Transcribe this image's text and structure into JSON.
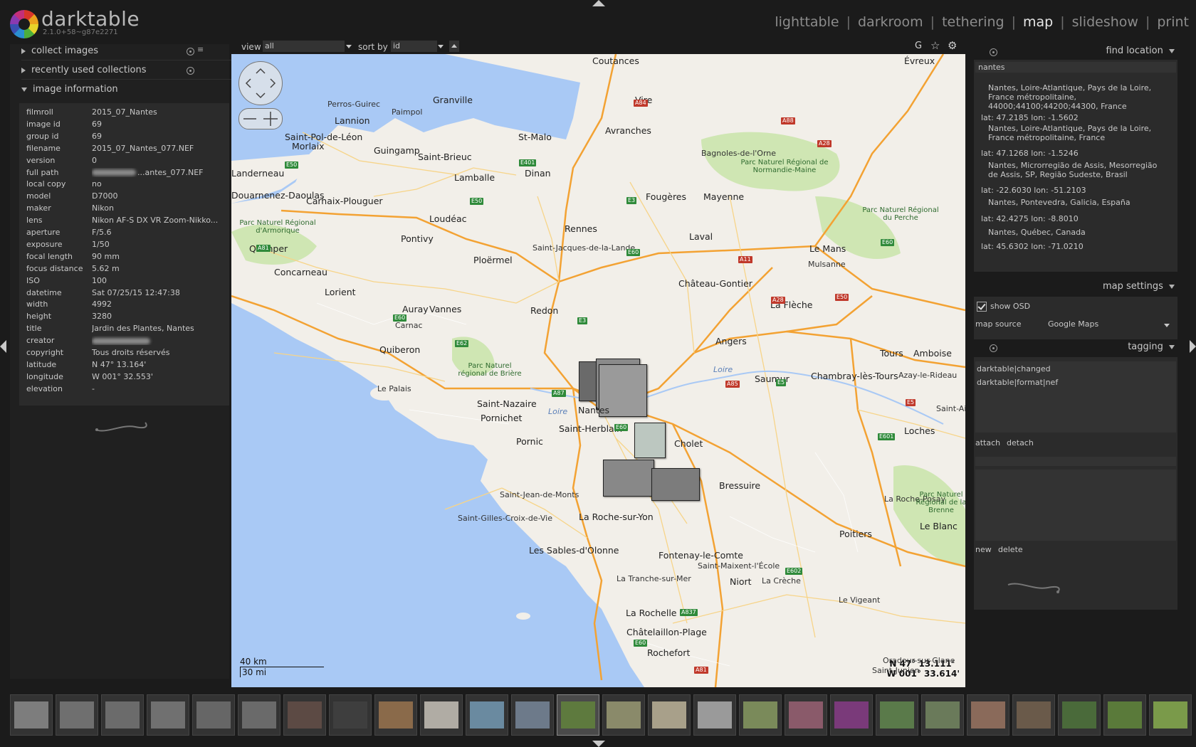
{
  "app": {
    "name": "darktable",
    "version": "2.1.0+58~g87e2271"
  },
  "views": [
    {
      "label": "lighttable",
      "active": false
    },
    {
      "label": "darkroom",
      "active": false
    },
    {
      "label": "tethering",
      "active": false
    },
    {
      "label": "map",
      "active": true
    },
    {
      "label": "slideshow",
      "active": false
    },
    {
      "label": "print",
      "active": false
    }
  ],
  "left_panel": {
    "collect_images": "collect images",
    "recently_used": "recently used collections",
    "image_information": "image information",
    "info": [
      {
        "key": "filmroll",
        "value": "2015_07_Nantes"
      },
      {
        "key": "image id",
        "value": "69"
      },
      {
        "key": "group id",
        "value": "69"
      },
      {
        "key": "filename",
        "value": "2015_07_Nantes_077.NEF"
      },
      {
        "key": "version",
        "value": "0"
      },
      {
        "key": "full path",
        "value": "...antes_077.NEF"
      },
      {
        "key": "local copy",
        "value": "no"
      },
      {
        "key": "model",
        "value": "D7000"
      },
      {
        "key": "maker",
        "value": "Nikon"
      },
      {
        "key": "lens",
        "value": "Nikon AF-S DX VR Zoom-Nikko..."
      },
      {
        "key": "aperture",
        "value": "F/5.6"
      },
      {
        "key": "exposure",
        "value": "1/50"
      },
      {
        "key": "focal length",
        "value": "90 mm"
      },
      {
        "key": "focus distance",
        "value": "5.62 m"
      },
      {
        "key": "ISO",
        "value": "100"
      },
      {
        "key": "datetime",
        "value": "Sat 07/25/15 12:47:38"
      },
      {
        "key": "width",
        "value": "4992"
      },
      {
        "key": "height",
        "value": "3280"
      },
      {
        "key": "title",
        "value": "Jardin des Plantes, Nantes"
      },
      {
        "key": "creator",
        "value": ""
      },
      {
        "key": "copyright",
        "value": "Tous droits réservés"
      },
      {
        "key": "latitude",
        "value": "N 47° 13.164'"
      },
      {
        "key": "longitude",
        "value": "W 001° 32.553'"
      },
      {
        "key": "elevation",
        "value": "-"
      }
    ]
  },
  "toolbar": {
    "view_label": "view",
    "view_value": "all",
    "sort_label": "sort by",
    "sort_value": "id",
    "g_label": "G"
  },
  "map": {
    "scale_km": "40 km",
    "scale_mi": "30 mi",
    "coord_lat": "N 47° 13.111'",
    "coord_lon": "W 001° 33.614'",
    "places": [
      {
        "name": "Coutances"
      },
      {
        "name": "Évreux"
      },
      {
        "name": "Granville"
      },
      {
        "name": "Vire"
      },
      {
        "name": "Perros-Guirec"
      },
      {
        "name": "Paimpol"
      },
      {
        "name": "Lannion"
      },
      {
        "name": "Avranches"
      },
      {
        "name": "St-Malo"
      },
      {
        "name": "Saint-Pol-de-Léon"
      },
      {
        "name": "Morlaix"
      },
      {
        "name": "Guingamp"
      },
      {
        "name": "Saint-Brieuc"
      },
      {
        "name": "Bagnoles-de-l'Orne"
      },
      {
        "name": "Landerneau"
      },
      {
        "name": "Lamballe"
      },
      {
        "name": "Dinan"
      },
      {
        "name": "Fougères"
      },
      {
        "name": "Mayenne"
      },
      {
        "name": "Douarnenez-Daoulas"
      },
      {
        "name": "Carhaix-Plouguer"
      },
      {
        "name": "Loudéac"
      },
      {
        "name": "Rennes"
      },
      {
        "name": "Laval"
      },
      {
        "name": "Le Mans"
      },
      {
        "name": "Quimper"
      },
      {
        "name": "Pontivy"
      },
      {
        "name": "Saint-Jacques-de-la-Lande"
      },
      {
        "name": "Concarneau"
      },
      {
        "name": "Ploërmel"
      },
      {
        "name": "Mulsanne"
      },
      {
        "name": "Château-Gontier"
      },
      {
        "name": "Lorient"
      },
      {
        "name": "La Flèche"
      },
      {
        "name": "Auray"
      },
      {
        "name": "Vannes"
      },
      {
        "name": "Redon"
      },
      {
        "name": "Carnac"
      },
      {
        "name": "Angers"
      },
      {
        "name": "Quiberon"
      },
      {
        "name": "Tours"
      },
      {
        "name": "Amboise"
      },
      {
        "name": "Saumur"
      },
      {
        "name": "Chambray-lès-Tours"
      },
      {
        "name": "Le Palais"
      },
      {
        "name": "Saint-Nazaire"
      },
      {
        "name": "Pornichet"
      },
      {
        "name": "Nantes"
      },
      {
        "name": "Saint-Herblain"
      },
      {
        "name": "Azay-le-Rideau"
      },
      {
        "name": "Pornic"
      },
      {
        "name": "Cholet"
      },
      {
        "name": "Loches"
      },
      {
        "name": "Bressuire"
      },
      {
        "name": "Saint-Jean-de-Monts"
      },
      {
        "name": "La Roche-Posay"
      },
      {
        "name": "Saint-Gilles-Croix-de-Vie"
      },
      {
        "name": "La Roche-sur-Yon"
      },
      {
        "name": "Les Sables-d'Olonne"
      },
      {
        "name": "Poitiers"
      },
      {
        "name": "Le Blanc"
      },
      {
        "name": "Fontenay-le-Comte"
      },
      {
        "name": "Saint-Maixent-l'École"
      },
      {
        "name": "La Tranche-sur-Mer"
      },
      {
        "name": "Niort"
      },
      {
        "name": "La Crèche"
      },
      {
        "name": "Le Vigeant"
      },
      {
        "name": "La Rochelle"
      },
      {
        "name": "Châtelaillon-Plage"
      },
      {
        "name": "Rochefort"
      },
      {
        "name": "Oradour-sur-Glane"
      },
      {
        "name": "Saint-Junien"
      },
      {
        "name": "Saint-Aignan"
      }
    ],
    "parks": [
      {
        "name": "Parc Naturel Régional de Normandie-Maine"
      },
      {
        "name": "Parc Naturel Régional d'Armorique"
      },
      {
        "name": "Parc Naturel Régional du Perche"
      },
      {
        "name": "Parc Naturel régional de Brière"
      },
      {
        "name": "Parc Naturel Régional de la Brenne"
      }
    ],
    "roads": [
      "A84",
      "A88",
      "A28",
      "E401",
      "E50",
      "E3",
      "E50",
      "E60",
      "A81",
      "A11",
      "A28",
      "E50",
      "E60",
      "E3",
      "E60",
      "E62",
      "A87",
      "E60",
      "A85",
      "E5",
      "E5",
      "E601",
      "E602",
      "A837",
      "E60",
      "A81"
    ],
    "rivers": [
      "Loire",
      "Loire"
    ]
  },
  "right_panel": {
    "find_location": "find location",
    "search_value": "nantes",
    "results": [
      {
        "name": "Nantes, Loire-Atlantique, Pays de la Loire, France métropolitaine, 44000;44100;44200;44300, France",
        "coords": "lat: 47.2185 lon: -1.5602"
      },
      {
        "name": "Nantes, Loire-Atlantique, Pays de la Loire, France métropolitaine, France",
        "coords": "lat: 47.1268 lon: -1.5246"
      },
      {
        "name": "Nantes, Microrregião de Assis, Mesorregião de Assis, SP, Região Sudeste, Brasil",
        "coords": "lat: -22.6030 lon: -51.2103"
      },
      {
        "name": "Nantes, Pontevedra, Galicia, España",
        "coords": "lat: 42.4275 lon: -8.8010"
      },
      {
        "name": "Nantes, Québec, Canada",
        "coords": "lat: 45.6302 lon: -71.0210"
      }
    ],
    "map_settings": "map settings",
    "show_osd": "show OSD",
    "map_source_label": "map source",
    "map_source_value": "Google Maps",
    "tagging": "tagging",
    "tags": [
      "darktable|changed",
      "darktable|format|nef"
    ],
    "attach": "attach",
    "detach": "detach",
    "new": "new",
    "delete": "delete"
  },
  "colors": {
    "map_water": "#a9c9f5",
    "map_land": "#f2efe9",
    "park": "#cfe6b3",
    "motorway": "#f3a233",
    "panel": "#202020",
    "background": "#1b1b1b"
  },
  "icons": [
    "darktable-logo-icon",
    "presets-icon",
    "menu-icon",
    "star-icon",
    "gear-icon",
    "osd-pan-icon",
    "osd-zoom-icon",
    "swirl-icon"
  ]
}
